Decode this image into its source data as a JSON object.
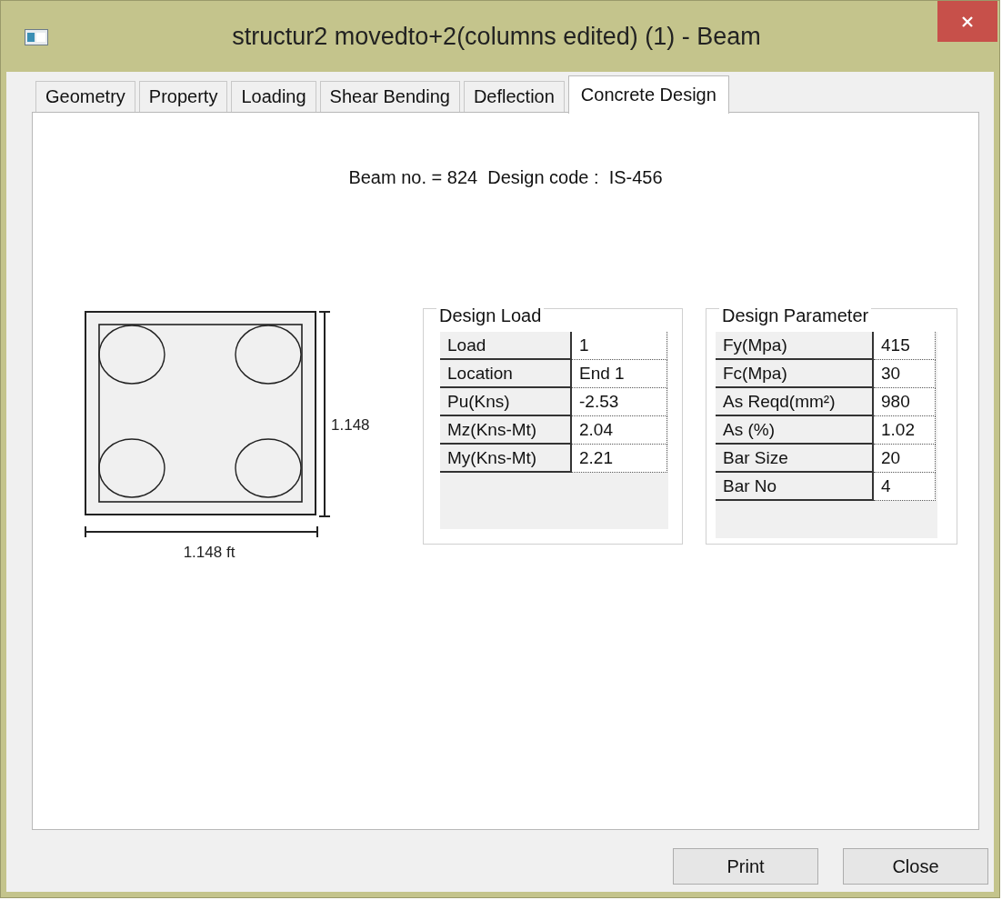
{
  "window": {
    "title": "structur2 movedto+2(columns edited) (1) - Beam"
  },
  "tabs": [
    {
      "label": "Geometry",
      "selected": false
    },
    {
      "label": "Property",
      "selected": false
    },
    {
      "label": "Loading",
      "selected": false
    },
    {
      "label": "Shear Bending",
      "selected": false
    },
    {
      "label": "Deflection",
      "selected": false
    },
    {
      "label": "Concrete Design",
      "selected": true
    }
  ],
  "heading": "Beam no. = 824  Design code :  IS-456",
  "section": {
    "height_label": "1.148",
    "width_label": "1.148 ft"
  },
  "groups": [
    {
      "title": "Design Load",
      "rows": [
        {
          "label": "Load",
          "value": "1"
        },
        {
          "label": "Location",
          "value": "End 1"
        },
        {
          "label": "Pu(Kns)",
          "value": "-2.53"
        },
        {
          "label": "Mz(Kns-Mt)",
          "value": "2.04"
        },
        {
          "label": "My(Kns-Mt)",
          "value": "2.21"
        }
      ]
    },
    {
      "title": "Design Parameter",
      "rows": [
        {
          "label": "Fy(Mpa)",
          "value": "415"
        },
        {
          "label": "Fc(Mpa)",
          "value": "30"
        },
        {
          "label": "As Reqd(mm²)",
          "value": "980"
        },
        {
          "label": "As (%)",
          "value": "1.02"
        },
        {
          "label": "Bar Size",
          "value": "20"
        },
        {
          "label": "Bar No",
          "value": "4"
        }
      ]
    }
  ],
  "buttons": [
    "Print",
    "Close"
  ]
}
